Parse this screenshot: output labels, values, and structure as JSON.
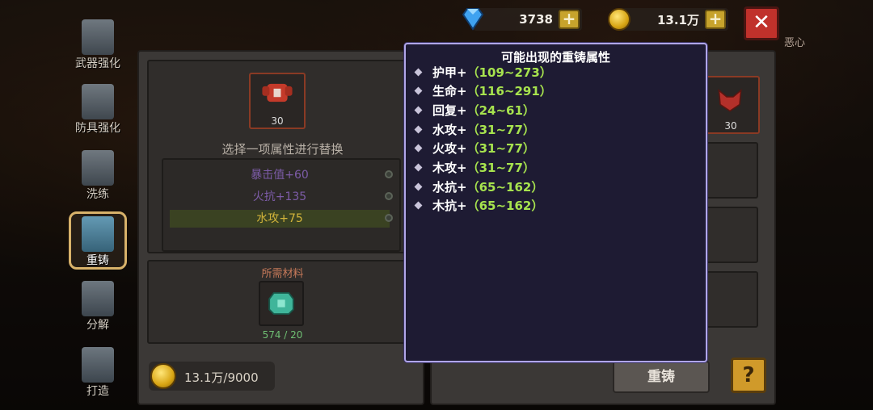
{
  "resources": {
    "gems": "3738",
    "coins": "13.1万"
  },
  "right_label": "恶心",
  "menu": [
    {
      "label": "武器强化",
      "icon": "sword-upgrade-icon"
    },
    {
      "label": "防具强化",
      "icon": "armor-upgrade-icon"
    },
    {
      "label": "洗练",
      "icon": "refine-sword-icon"
    },
    {
      "label": "重铸",
      "icon": "armor-recast-icon",
      "active": true
    },
    {
      "label": "分解",
      "icon": "cauldron-icon"
    },
    {
      "label": "打造",
      "icon": "forge-hammer-icon"
    }
  ],
  "left_panel": {
    "item_level": "30",
    "instruction": "选择一项属性进行替换",
    "options": [
      {
        "text": "暴击值+60",
        "color": "#7d5ca8"
      },
      {
        "text": "火抗+135",
        "color": "#7d5ca8"
      },
      {
        "text": "水攻+75",
        "color": "#d2b43a",
        "selected": true
      }
    ],
    "materials_title": "所需材料",
    "material_count": "574 / 20",
    "cost": "13.1万/9000"
  },
  "right_panel": {
    "item_level": "30",
    "recast_label": "重铸",
    "help_label": "?"
  },
  "popup": {
    "title": "可能出现的重铸属性",
    "rows": [
      {
        "attr": "护甲+",
        "range": "（109~273）"
      },
      {
        "attr": "生命+",
        "range": "（116~291）"
      },
      {
        "attr": "回复+",
        "range": "（24~61）"
      },
      {
        "attr": "水攻+",
        "range": "（31~77）"
      },
      {
        "attr": "火攻+",
        "range": "（31~77）"
      },
      {
        "attr": "木攻+",
        "range": "（31~77）"
      },
      {
        "attr": "水抗+",
        "range": "（65~162）"
      },
      {
        "attr": "木抗+",
        "range": "（65~162）"
      }
    ]
  },
  "colors": {
    "popup_bg": "#1e1b33",
    "popup_border": "#b0a6e8",
    "range_green": "#a7e34e",
    "selected_option": "#d2b43a",
    "option_purple": "#7d5ca8"
  }
}
